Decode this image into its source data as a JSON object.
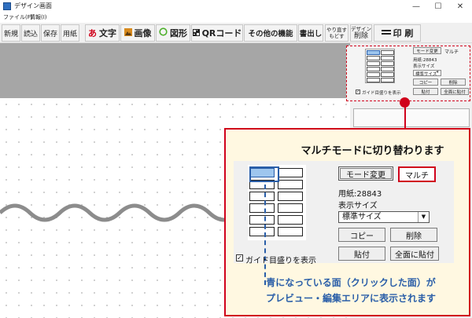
{
  "window": {
    "title": "デザイン画面",
    "minimize_glyph": "—",
    "maximize_glyph": "☐",
    "close_glyph": "✕"
  },
  "menu": {
    "file": "ファイル(F)",
    "info": "情報(I)"
  },
  "toolbar": {
    "new": "新規",
    "load": "読込",
    "save": "保存",
    "paper": "用紙",
    "text": "文字",
    "text_icon": "あ",
    "image": "画像",
    "shape": "図形",
    "qr": "QRコード",
    "other": "その他の機能",
    "export": "書出し",
    "redo_line1": "やり直す",
    "redo_line2": "もどす",
    "delete_line1": "デザイン",
    "delete_line2": "削除",
    "print": "印 刷"
  },
  "mini_panel": {
    "mode_button": "モード変更",
    "mode_value": "マルチ",
    "paper_label": "用紙:28843",
    "display_size_label": "表示サイズ",
    "display_size_value": "標準サイズ",
    "copy_button": "コピー",
    "delete_button": "削除",
    "paste_button": "貼付",
    "paste_all_button": "全面に貼付",
    "guide_label": "ガイド目盛りを表示",
    "guide_checked": "✓"
  },
  "callout": {
    "title": "マルチモードに切り替わります",
    "mode_button": "モード変更",
    "mode_value": "マルチ",
    "paper_label": "用紙:28843",
    "display_size_label": "表示サイズ",
    "display_size_value": "標準サイズ",
    "copy_button": "コピー",
    "delete_button": "削除",
    "paste_button": "貼付",
    "paste_all_button": "全面に貼付",
    "guide_label": "ガイド目盛りを表示",
    "guide_checked": "✓",
    "note_line1": "青になっている面（クリックした面）が",
    "note_line2": "プレビュー・編集エリアに表示されます"
  },
  "colors": {
    "accent_red": "#d0021b",
    "note_blue": "#2a5ea8",
    "selected_face": "#9ec6ee",
    "callout_bg": "#fff8e1",
    "preview_gray": "#a6a6a6"
  }
}
